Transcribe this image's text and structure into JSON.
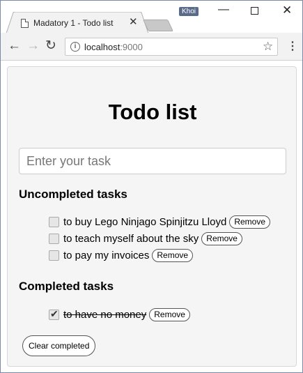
{
  "browser": {
    "tab_title": "Madatory 1 - Todo list",
    "profile_name": "Khoi",
    "url_host": "localhost",
    "url_port": ":9000"
  },
  "app": {
    "title": "Todo list",
    "input_placeholder": "Enter your task",
    "uncompleted_heading": "Uncompleted tasks",
    "completed_heading": "Completed tasks",
    "remove_label": "Remove",
    "clear_label": "Clear completed",
    "uncompleted": [
      {
        "text": "to buy Lego Ninjago Spinjitzu Lloyd",
        "done": false
      },
      {
        "text": "to teach myself about the sky",
        "done": false
      },
      {
        "text": "to pay my invoices",
        "done": false
      }
    ],
    "completed": [
      {
        "text": "to have no money",
        "done": true
      }
    ]
  }
}
